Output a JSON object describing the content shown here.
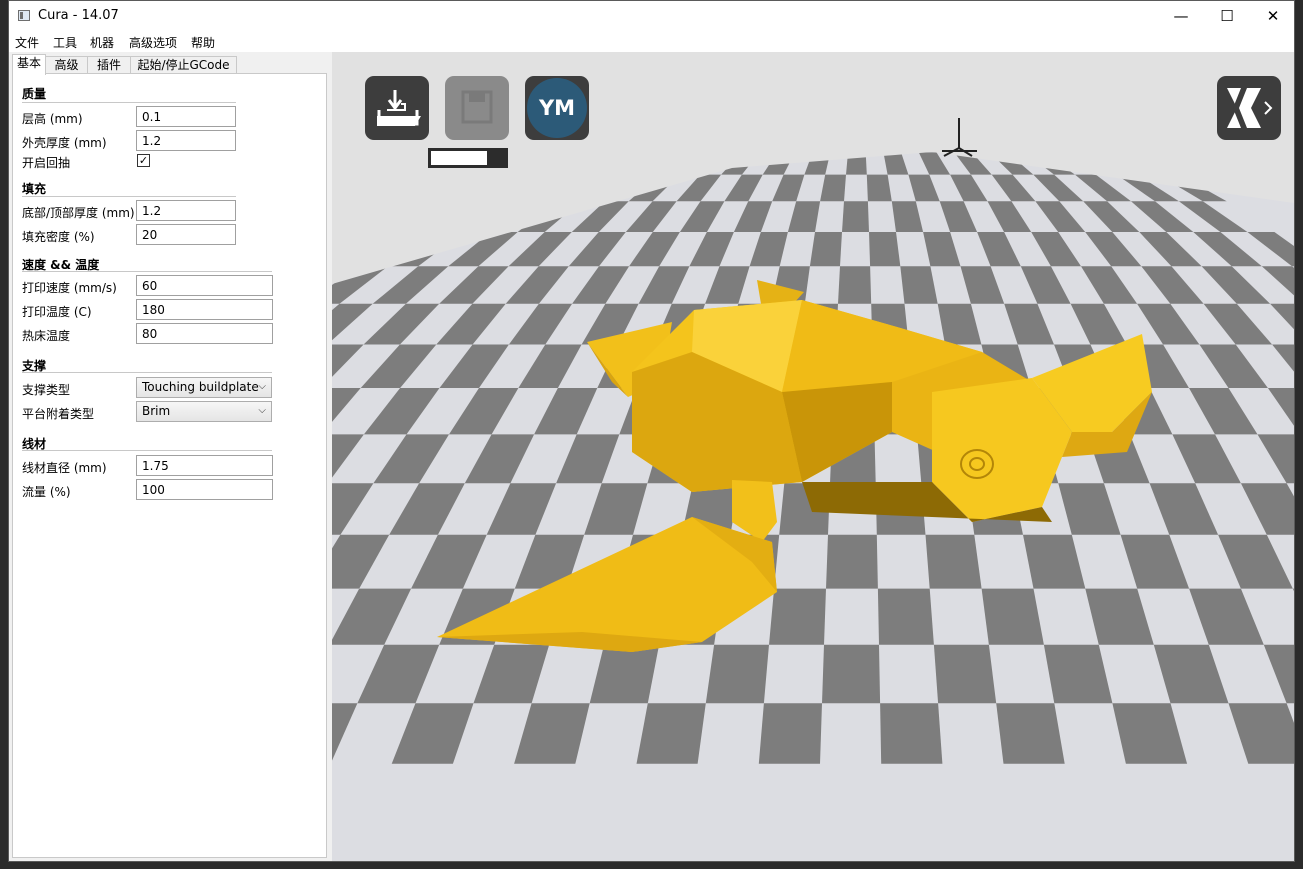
{
  "window": {
    "title": "Cura - 14.07",
    "controls": {
      "minimize": "—",
      "maximize": "☐",
      "close": "✕"
    }
  },
  "menu": [
    "文件",
    "工具",
    "机器",
    "高级选项",
    "帮助"
  ],
  "tabs": [
    "基本",
    "高级",
    "插件",
    "起始/停止GCode"
  ],
  "sections": {
    "quality": {
      "title": "质量",
      "layer_height": {
        "label": "层高 (mm)",
        "value": "0.1"
      },
      "shell_thickness": {
        "label": "外壳厚度 (mm)",
        "value": "1.2"
      },
      "retraction": {
        "label": "开启回抽",
        "checked": true,
        "mark": "✓"
      }
    },
    "fill": {
      "title": "填充",
      "bottom_top_thickness": {
        "label": "底部/顶部厚度 (mm)",
        "value": "1.2"
      },
      "fill_density": {
        "label": "填充密度 (%)",
        "value": "20"
      }
    },
    "speed": {
      "title": "速度 && 温度",
      "print_speed": {
        "label": "打印速度 (mm/s)",
        "value": "60"
      },
      "print_temp": {
        "label": "打印温度 (C)",
        "value": "180"
      },
      "bed_temp": {
        "label": "热床温度",
        "value": "80"
      }
    },
    "support": {
      "title": "支撑",
      "support_type": {
        "label": "支撑类型",
        "value": "Touching buildplate"
      },
      "adhesion_type": {
        "label": "平台附着类型",
        "value": "Brim"
      }
    },
    "filament": {
      "title": "线材",
      "diameter": {
        "label": "线材直径 (mm)",
        "value": "1.75"
      },
      "flow": {
        "label": "流量 (%)",
        "value": "100"
      }
    }
  },
  "toolbar": {
    "ym_label": "YM",
    "progress": 0.75
  },
  "colors": {
    "model": "#f2c01a",
    "checker_dark": "#7d7d7d",
    "checker_light": "#dcdde2",
    "tool_button": "#3d3d3d",
    "ym_circle": "#2c5a78"
  }
}
